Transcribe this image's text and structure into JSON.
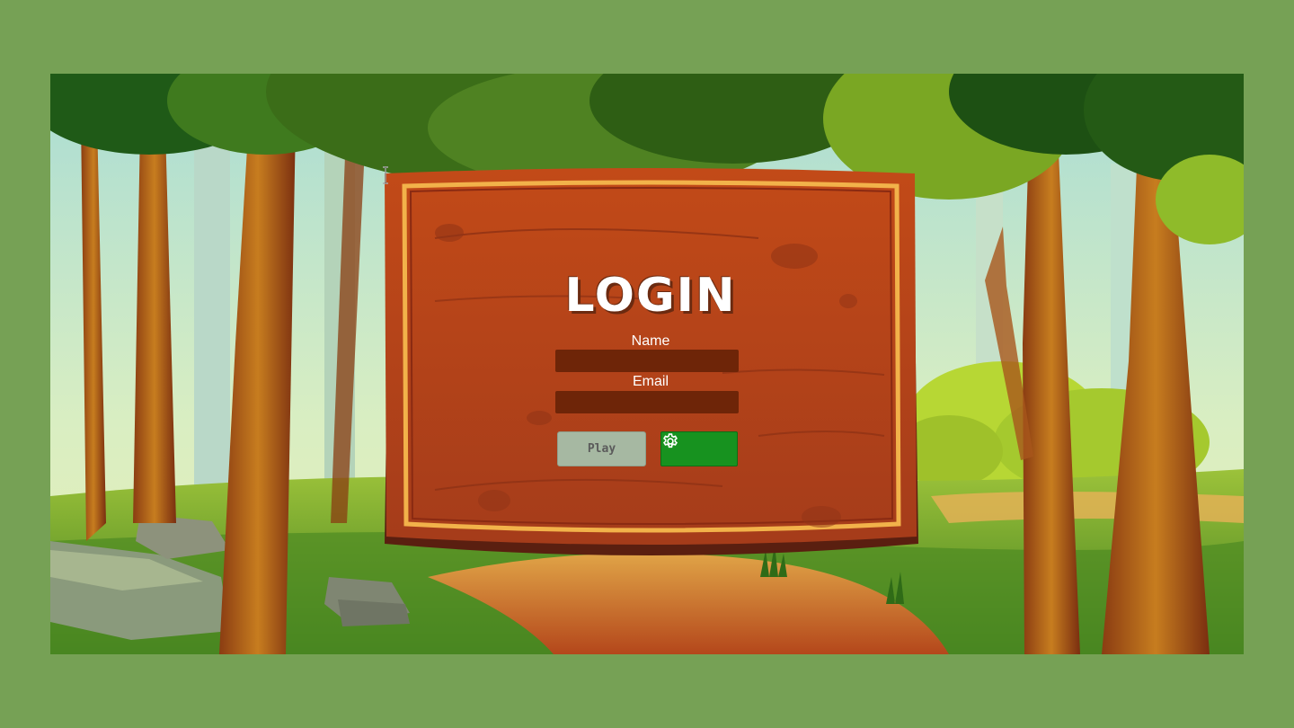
{
  "login": {
    "title": "LOGIN",
    "name_label": "Name",
    "name_value": "",
    "email_label": "Email",
    "email_value": "",
    "play_label": "Play",
    "settings_icon": "gear-icon"
  },
  "colors": {
    "page_border": "#76a155",
    "board_wood": "#b5461c",
    "board_frame": "#e8a23b",
    "input_bg": "#6e2508",
    "play_button": "#a6b8a2",
    "settings_button": "#17921f"
  }
}
